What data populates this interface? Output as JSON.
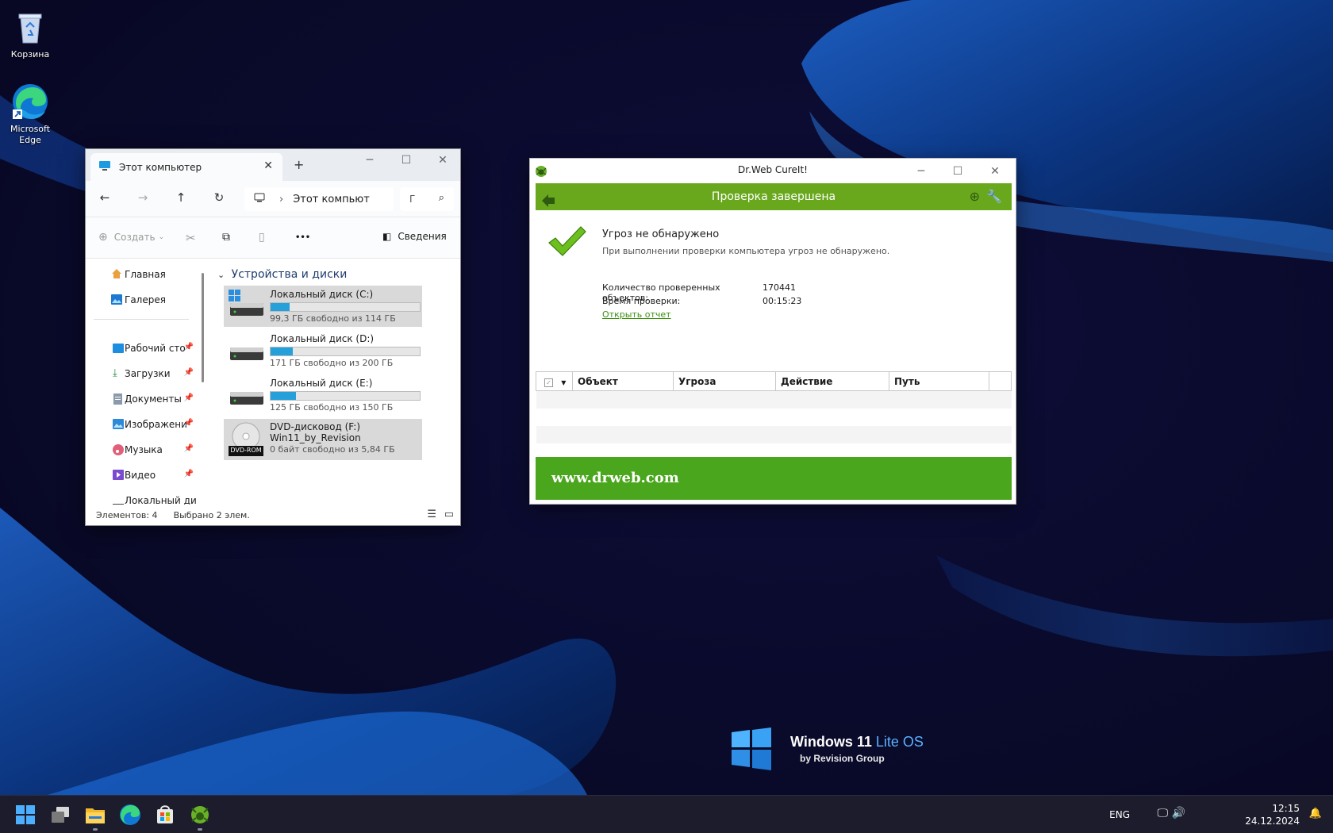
{
  "desktop": {
    "icons": [
      {
        "label": "Корзина",
        "icon": "recycle-bin-icon"
      },
      {
        "label": "Microsoft Edge",
        "icon": "edge-icon"
      }
    ],
    "logo": {
      "line1_a": "Windows 11 ",
      "line1_b": "Lite OS",
      "line2": "by Revision Group"
    }
  },
  "explorer": {
    "tab_title": "Этот компьютер",
    "new_tab": "+",
    "address": "Этот компьют",
    "search_placeholder": "Г",
    "toolbar": {
      "create": "Создать",
      "more": "•••",
      "details": "Сведения"
    },
    "nav": {
      "top": [
        {
          "label": "Главная",
          "icon": "home-icon"
        },
        {
          "label": "Галерея",
          "icon": "gallery-icon"
        }
      ],
      "pinned": [
        {
          "label": "Рабочий сто",
          "icon": "desktop-folder-icon"
        },
        {
          "label": "Загрузки",
          "icon": "downloads-icon"
        },
        {
          "label": "Документы",
          "icon": "documents-icon"
        },
        {
          "label": "Изображени",
          "icon": "pictures-icon"
        },
        {
          "label": "Музыка",
          "icon": "music-icon"
        },
        {
          "label": "Видео",
          "icon": "video-icon"
        },
        {
          "label": "Локальный дис",
          "icon": "drive-icon"
        }
      ]
    },
    "section": "Устройства и диски",
    "drives": [
      {
        "name": "Локальный диск (C:)",
        "free": "99,3 ГБ свободно из 114 ГБ",
        "used_fraction": 0.13,
        "selected": true
      },
      {
        "name": "Локальный диск (D:)",
        "free": "171 ГБ свободно из 200 ГБ",
        "used_fraction": 0.15,
        "selected": false
      },
      {
        "name": "Локальный диск (E:)",
        "free": "125 ГБ свободно из 150 ГБ",
        "used_fraction": 0.17,
        "selected": false
      }
    ],
    "dvd": {
      "name": "DVD-дисковод (F:)",
      "label": "Win11_by_Revision",
      "free": "0 байт свободно из 5,84 ГБ",
      "badge": "DVD-ROM"
    },
    "status": {
      "items": "Элементов: 4",
      "selected": "Выбрано 2 элем."
    }
  },
  "drweb": {
    "title": "Dr.Web CureIt!",
    "header": "Проверка завершена",
    "result_title": "Угроз не обнаружено",
    "result_text": "При выполнении проверки компьютера угроз не обнаружено.",
    "stats": [
      {
        "label": "Количество проверенных объектов:",
        "value": "170441"
      },
      {
        "label": "Время проверки:",
        "value": "00:15:23"
      }
    ],
    "report_link": "Открыть отчет",
    "columns": [
      "Объект",
      "Угроза",
      "Действие",
      "Путь"
    ],
    "footer": "www.drweb.com"
  },
  "taskbar": {
    "apps": [
      "start-icon",
      "task-view-icon",
      "file-explorer-icon",
      "edge-icon",
      "store-icon",
      "drweb-icon"
    ],
    "lang": "ENG",
    "time": "12:15",
    "date": "24.12.2024"
  },
  "colors": {
    "drweb_green": "#69a81d",
    "drweb_footer": "#4aa61c",
    "accent": "#26a0da"
  }
}
